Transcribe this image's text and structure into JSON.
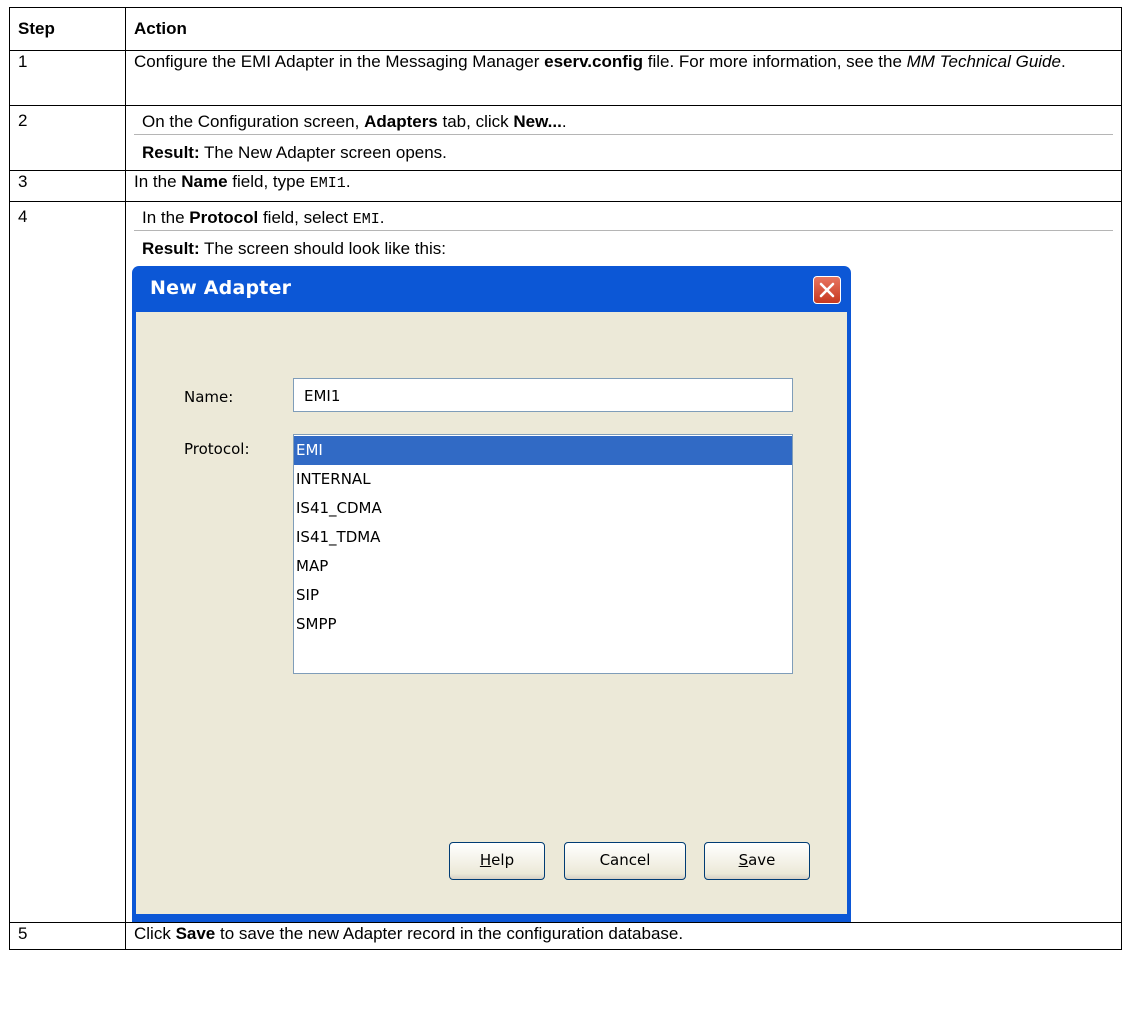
{
  "table": {
    "headers": [
      "Step",
      "Action"
    ],
    "rows": [
      {
        "step": "1",
        "t1": "Configure the EMI Adapter in the Messaging Manager ",
        "b1": "eserv.config",
        "t2": " file. For more information, see the ",
        "i1": "MM Technical Guide",
        "t3": "."
      },
      {
        "step": "2",
        "t1": "On the Configuration screen, ",
        "b1": "Adapters",
        "t2": " tab, click ",
        "b2": "New...",
        "t3": ".",
        "result_label": "Result:",
        "result_text": " The New Adapter screen opens."
      },
      {
        "step": "3",
        "t1": "In the ",
        "b1": "Name",
        "t2": " field, type ",
        "code": "EMI1",
        "t3": "."
      },
      {
        "step": "4",
        "t1": "In the ",
        "b1": "Protocol",
        "t2": " field, select ",
        "code": "EMI",
        "t3": ".",
        "result_label": "Result:",
        "result_text": " The screen should look like this:"
      },
      {
        "step": "5",
        "t1": "Click ",
        "b1": "Save",
        "t2": " to save the new Adapter record in the configuration database."
      }
    ]
  },
  "dialog": {
    "title": "New Adapter",
    "name_label": "Name:",
    "name_value": "EMI1",
    "protocol_label": "Protocol:",
    "protocols": [
      "EMI",
      "INTERNAL",
      "IS41_CDMA",
      "IS41_TDMA",
      "MAP",
      "SIP",
      "SMPP"
    ],
    "selected_protocol": "EMI",
    "buttons": {
      "help": {
        "pre": "",
        "mnemonic": "H",
        "post": "elp"
      },
      "cancel": {
        "pre": "Cancel",
        "mnemonic": "",
        "post": ""
      },
      "save": {
        "pre": "",
        "mnemonic": "S",
        "post": "ave"
      }
    },
    "colors": {
      "titlebar": "#0c57d6",
      "client": "#ece9d8",
      "selection": "#316ac5",
      "close": "#c6381f"
    }
  }
}
